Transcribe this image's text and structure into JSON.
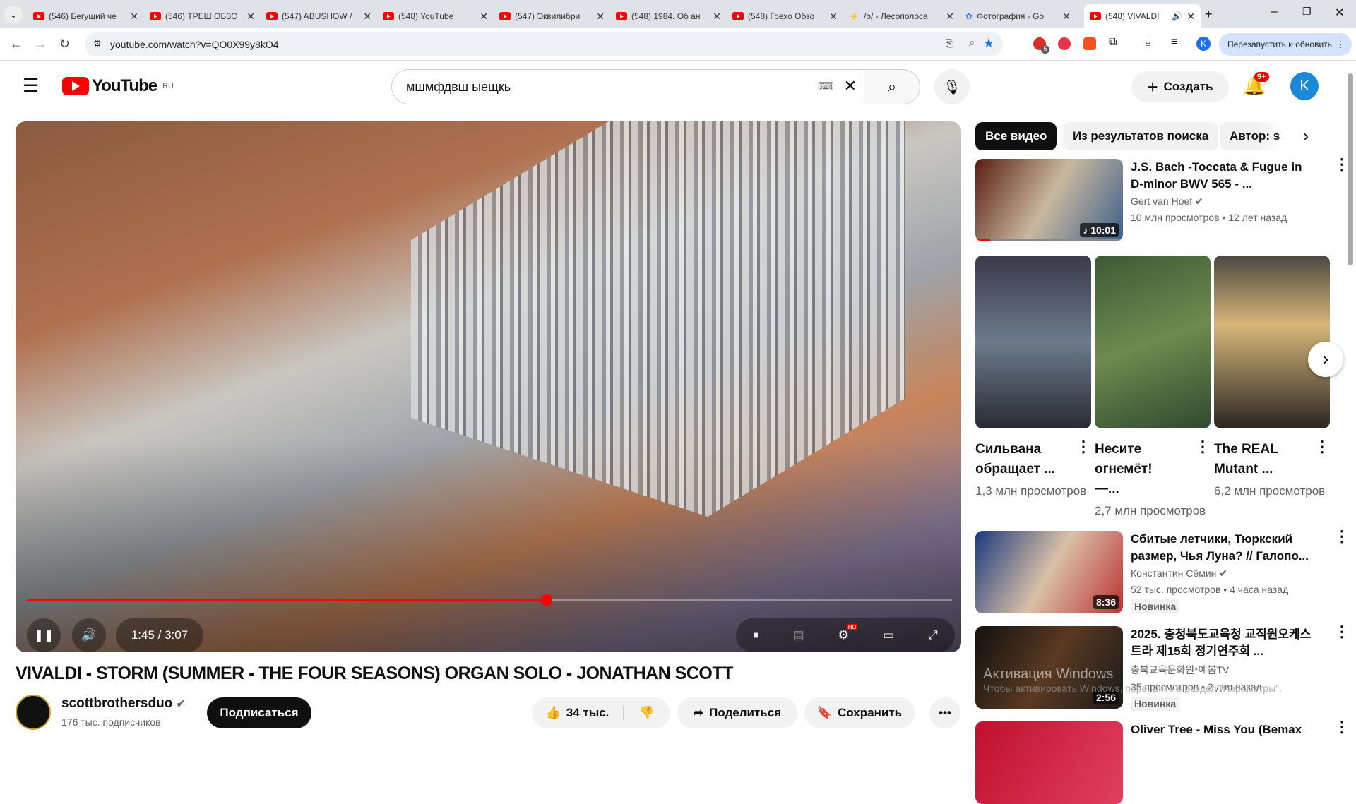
{
  "browser": {
    "tabs": [
      {
        "title": "(546) Бегущий че"
      },
      {
        "title": "(546) ТРЕШ ОБЗО"
      },
      {
        "title": "(547) ABUSHOW /"
      },
      {
        "title": "(548) YouTube"
      },
      {
        "title": "(547) Эквилибри"
      },
      {
        "title": "(548) 1984. Об ан"
      },
      {
        "title": "(548) Грехо Обзо"
      },
      {
        "title": "/b/ - Лесополоса"
      },
      {
        "title": "Фотография - Go"
      },
      {
        "title": "(548) VIVALDI"
      }
    ],
    "url": "youtube.com/watch?v=QO0X99y8kO4",
    "restart_label": "Перезапустить и обновить",
    "profile_initial": "K",
    "ext_badge": "5"
  },
  "header": {
    "logo": "YouTube",
    "region": "RU",
    "search_value": "мшмфдвш ыещкь",
    "create_label": "Создать",
    "notifications": "9+",
    "avatar": "K"
  },
  "player": {
    "time": "1:45 / 3:07",
    "progress": 0.5615,
    "hd": "HD"
  },
  "video": {
    "title": "VIVALDI - STORM (SUMMER - THE FOUR SEASONS) ORGAN SOLO - JONATHAN SCOTT",
    "channel": "scottbrothersduo",
    "subscribers": "176 тыс. подписчиков",
    "subscribe": "Подписаться",
    "likes": "34 тыс.",
    "share": "Поделиться",
    "save": "Сохранить"
  },
  "sidebar": {
    "chips": [
      "Все видео",
      "Из результатов поиска",
      "Автор: s"
    ],
    "items": [
      {
        "title": "J.S. Bach -Toccata & Fugue in D-minor BWV 565 - ...",
        "channel": "Gert van Hoef",
        "stats": "10 млн просмотров • 12 лет назад",
        "duration": "10:01"
      },
      {
        "title": "Сбитые летчики, Тюркский размер, Чья Луна? // Галопо...",
        "channel": "Константин Сёмин",
        "stats": "52 тыс. просмотров • 4 часа назад",
        "duration": "8:36",
        "badge": "Новинка"
      },
      {
        "title": "2025. 충청북도교육청 교직원오케스트라 제15회 정기연주회 ...",
        "channel": "충북교육문화원*예봄TV",
        "stats": "35 просмотров • 2 дня назад",
        "duration": "2:56",
        "badge": "Новинка"
      },
      {
        "title": "Oliver Tree - Miss You (Bemax"
      }
    ],
    "shorts": [
      {
        "title": "Сильвана обращает ...",
        "views": "1,3 млн просмотров"
      },
      {
        "title": "Несите огнемёт! —...",
        "views": "2,7 млн просмотров"
      },
      {
        "title": "The REAL Mutant ...",
        "views": "6,2 млн просмотров"
      }
    ]
  },
  "watermark": {
    "line1": "Активация Windows",
    "line2": "Чтобы активировать Windows, перейдите в раздел \"Параметры\"."
  }
}
